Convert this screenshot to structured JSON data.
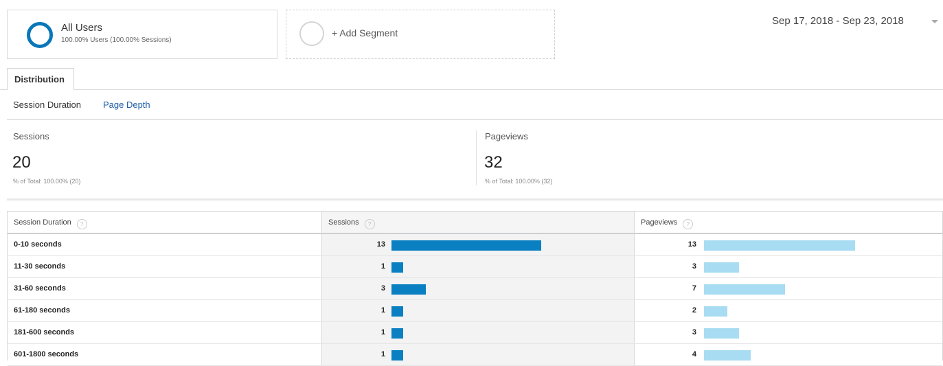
{
  "segments": {
    "all_users": {
      "title": "All Users",
      "subtitle": "100.00% Users (100.00% Sessions)"
    },
    "add_segment_label": "+ Add Segment"
  },
  "date_range": "Sep 17, 2018 - Sep 23, 2018",
  "tabs": [
    {
      "label": "Distribution"
    }
  ],
  "sub_nav": {
    "session_duration": "Session Duration",
    "page_depth": "Page Depth"
  },
  "scorecards": [
    {
      "label": "Sessions",
      "value": "20",
      "total": "% of Total: 100.00% (20)"
    },
    {
      "label": "Pageviews",
      "value": "32",
      "total": "% of Total: 100.00% (32)"
    }
  ],
  "table": {
    "headers": [
      "Session Duration",
      "Sessions",
      "Pageviews"
    ],
    "help_glyph": "?",
    "rows": [
      {
        "duration": "0-10 seconds",
        "sessions": 13,
        "pageviews": 13
      },
      {
        "duration": "11-30 seconds",
        "sessions": 1,
        "pageviews": 3
      },
      {
        "duration": "31-60 seconds",
        "sessions": 3,
        "pageviews": 7
      },
      {
        "duration": "61-180 seconds",
        "sessions": 1,
        "pageviews": 2
      },
      {
        "duration": "181-600 seconds",
        "sessions": 1,
        "pageviews": 3
      },
      {
        "duration": "601-1800 seconds",
        "sessions": 1,
        "pageviews": 4
      }
    ]
  },
  "colors": {
    "accent": "#0a77b8",
    "sessions_bar": "#0a7fc1",
    "pageviews_bar": "#a7dcf2",
    "link": "#1a5ca8"
  },
  "icons": {
    "segment_all": "circle-ring-icon",
    "segment_add": "empty-circle-icon",
    "date_dropdown": "caret-down-icon",
    "help": "help-circle-icon"
  }
}
